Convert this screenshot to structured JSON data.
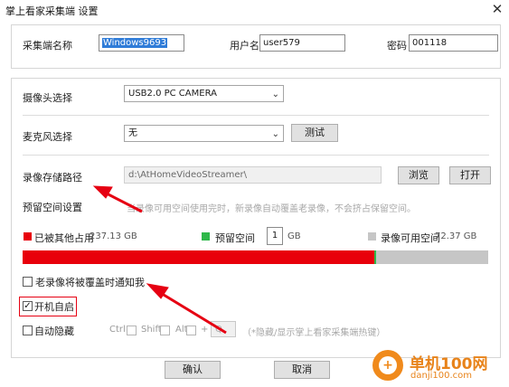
{
  "window": {
    "title": "掌上看家采集端 设置",
    "close_glyph": "✕"
  },
  "account": {
    "name_label": "采集端名称",
    "name_value": "Windows9693",
    "user_label": "用户名",
    "user_value": "user579",
    "password_label": "密码",
    "password_value": "001118"
  },
  "camera": {
    "label": "摄像头选择",
    "value": "USB2.0 PC CAMERA"
  },
  "mic": {
    "label": "麦克风选择",
    "value": "无",
    "test_button": "测试"
  },
  "storage": {
    "path_label": "录像存储路径",
    "path_value": "d:\\AtHomeVideoStreamer\\",
    "browse_button": "浏览",
    "open_button": "打开",
    "reserve_label": "预留空间设置",
    "reserve_hint": "当录像可用空间使用完时，新录像自动覆盖老录像，不会挤占保留空间。",
    "used_other_label": "已被其他占用",
    "used_other_value": "237.13 GB",
    "reserved_label": "预留空间",
    "reserved_input": "1",
    "reserved_unit": "GB",
    "available_label": "录像可用空间",
    "available_value": "72.37 GB",
    "usage_bar": {
      "used_fraction": 0.755,
      "reserved_fraction": 0.003
    },
    "colors": {
      "used": "#e8000b",
      "reserved": "#2fb84a",
      "available": "#c6c6c6"
    }
  },
  "options": {
    "notify_label": "老录像将被覆盖时通知我",
    "autostart_label": "开机自启",
    "autostart_checked": true,
    "autohide_label": "自动隐藏",
    "hotkey": {
      "ctrl": "Ctrl",
      "shift": "Shift",
      "alt": "Alt",
      "plus": "+",
      "key": "Q",
      "hint": "（*隐藏/显示掌上看家采集端热键）"
    }
  },
  "footer": {
    "ok_button": "确认",
    "cancel_button": "取消"
  },
  "watermark": {
    "text_top": "单机100网",
    "text_bottom": "danji100.com"
  },
  "annotations": {
    "arrow_color": "#e60012",
    "highlight_color": "#e60012"
  }
}
